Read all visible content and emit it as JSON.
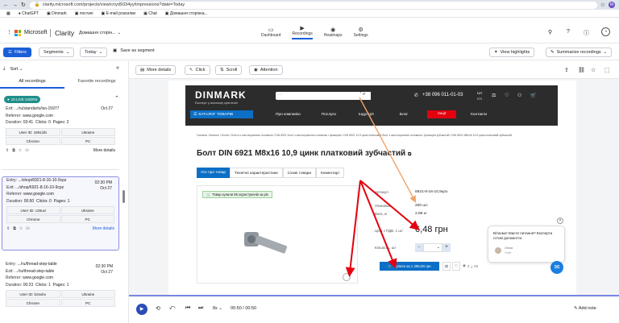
{
  "browser": {
    "url": "clarity.microsoft.com/projects/view/cnyd9334yy/impressions?date=Today",
    "bookmarks": [
      "ChatGPT",
      "Dinmark",
      "постачі",
      "E-mail розсилки",
      "Chat",
      "Домашня сторінка..."
    ]
  },
  "header": {
    "brand": "Microsoft",
    "product": "Clarity",
    "project": "Домашня сторін...",
    "nav": [
      {
        "label": "Dashboard"
      },
      {
        "label": "Recordings"
      },
      {
        "label": "Heatmaps"
      },
      {
        "label": "Settings"
      }
    ],
    "avatar": "M"
  },
  "toolbar": {
    "filters": "Filters",
    "segments": "Segments",
    "date": "Today",
    "save_segment": "Save as segment",
    "view_highlights": "View highlights",
    "summarize": "Summarize recordings"
  },
  "sidebar": {
    "sort": "Sort",
    "tabs": [
      "All recordings",
      "Favorite recordings"
    ],
    "live_badge": "10 LIVE USERS",
    "cards": [
      {
        "entry": "",
        "exit": ".../ru/standarts/iso-15977",
        "time": "",
        "date": "Oct 27",
        "referrer": "www.google.com",
        "duration": "03:41",
        "clicks": "0",
        "pages": "2",
        "user": "User ID: 1891i2b",
        "country": "Ukraine",
        "browser": "Chrome",
        "device": "PC",
        "details": "More details"
      },
      {
        "entry": ".../shop/6921-8-16-10-9cpz",
        "exit": ".../shop/6921-8-16-10-9cpz",
        "time": "02:30 PM",
        "date": "Oct 27",
        "referrer": "www.google.com",
        "duration": "00:50",
        "clicks": "0",
        "pages": "1",
        "user": "User ID: c28uvi",
        "country": "Ukraine",
        "browser": "Chrome",
        "device": "PC",
        "details": "More details"
      },
      {
        "entry": ".../ru/thread-step-table",
        "exit": ".../ru/thread-step-table",
        "time": "02:30 PM",
        "date": "Oct 27",
        "referrer": "www.google.com",
        "duration": "00:23",
        "clicks": "1",
        "pages": "1",
        "user": "User ID: b2sxbv",
        "country": "Ukraine",
        "browser": "Chrome",
        "device": "PC"
      }
    ]
  },
  "player": {
    "more_details": "More details",
    "click": "Click",
    "scroll": "Scroll",
    "attention": "Attention",
    "speed": "8x",
    "time": "00:50 / 00:50",
    "add_note": "Add note"
  },
  "site": {
    "logo": "DINMARK",
    "tagline": "Експерт у якісному кріпленні",
    "phone": "+38 096 011-01-03",
    "lang1": "UA",
    "lang2": "EN",
    "menu_catalog": "КАТАЛОГ ТОВАРІВ",
    "menu": [
      "Про компанію",
      "Послуги",
      "Індустрії",
      "Блог",
      "Акції",
      "Контакти"
    ],
    "breadcrumb": "Головна / Каталог / Болти / Болти з шестигранною головкою / DIN 6921 Болт з шестигранною головкою і фланцем / DIN 6921 10.9 цинк платковий болт з шестигранною головкою і фланцем зубчастий / DIN 6921 M8x16 10.9 цинк платковий зубчастий",
    "title": "Болт DIN 6921 M8x16 10,9 цинк платковий зубчастий",
    "tabs": [
      "Усе про товар",
      "Технічні характеристики",
      "Схожі товари",
      "Коментарі"
    ],
    "bought": "Товар купили 85 користувачів за рік",
    "art_label": "Артикул",
    "art_value": "6921-8-16-10,9цпз",
    "pack_label": "Упаковка",
    "pack_value": "200 шт.",
    "weight_label": "Вага, кг",
    "weight_value": "2,99 кг",
    "price_label": "Ціна з ПДВ, 1 шт",
    "price": "6,48 грн",
    "qty_label": "Кількість, шт",
    "qty_minus": "-",
    "qty_plus": "+",
    "buy": "Купити за 1 296,00 грн",
    "rating": "3",
    "views": "83",
    "chat": "Вітаємо! Маєте питання? Експерти готові допомогти.",
    "chat_agent": "Ольга",
    "chat_role": "Onlin"
  },
  "colors": {
    "accent": "#1a5fd8",
    "site_blue": "#0b6fc5",
    "arrow_red": "#e3000f",
    "arrow_orange": "#f0a46a"
  }
}
